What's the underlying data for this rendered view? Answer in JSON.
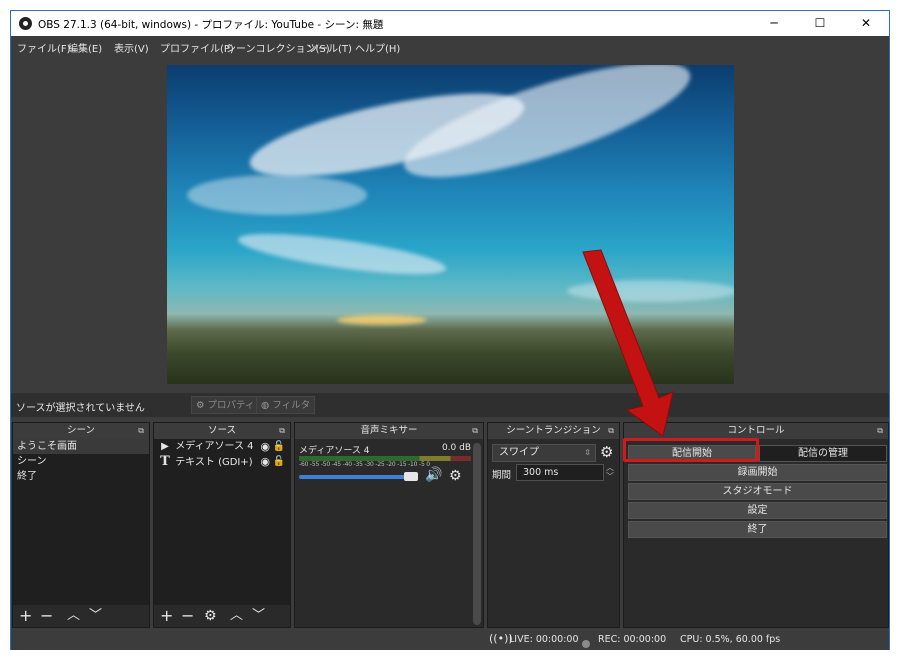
{
  "window": {
    "title": "OBS 27.1.3 (64-bit, windows) - プロファイル: YouTube - シーン: 無題",
    "minimize": "─",
    "maximize": "☐",
    "close": "✕"
  },
  "menu": [
    "ファイル(F)",
    "編集(E)",
    "表示(V)",
    "プロファイル(P)",
    "シーンコレクション(S)",
    "ツール(T)",
    "ヘルプ(H)"
  ],
  "status": {
    "no_source": "ソースが選択されていません",
    "properties": "プロパティ",
    "filters": "フィルタ"
  },
  "scenes": {
    "title": "シーン",
    "items": [
      "ようこそ画面",
      "シーン",
      "終了"
    ]
  },
  "sources": {
    "title": "ソース",
    "items": [
      {
        "icon": "▶",
        "label": "メディアソース 4"
      },
      {
        "icon": "T",
        "label": "テキスト (GDI+)"
      }
    ]
  },
  "mixer": {
    "title": "音声ミキサー",
    "channel": "メディアソース 4",
    "level": "0.0 dB",
    "ticks": "-60 -55 -50 -45 -40 -35 -30 -25 -20 -15 -10 -5 0",
    "volume": 1.0
  },
  "transitions": {
    "title": "シーントランジション",
    "selected": "スワイプ",
    "duration_label": "期間",
    "duration": "300 ms"
  },
  "controls": {
    "title": "コントロール",
    "start_stream": "配信開始",
    "manage_stream": "配信の管理",
    "start_recording": "録画開始",
    "studio_mode": "スタジオモード",
    "settings": "設定",
    "exit": "終了"
  },
  "statusbar": {
    "live": "LIVE: 00:00:00",
    "rec": "REC: 00:00:00",
    "cpu": "CPU: 0.5%, 60.00 fps"
  },
  "colors": {
    "highlight": "#d31a1a",
    "accent_blue": "#3f7fd8"
  }
}
